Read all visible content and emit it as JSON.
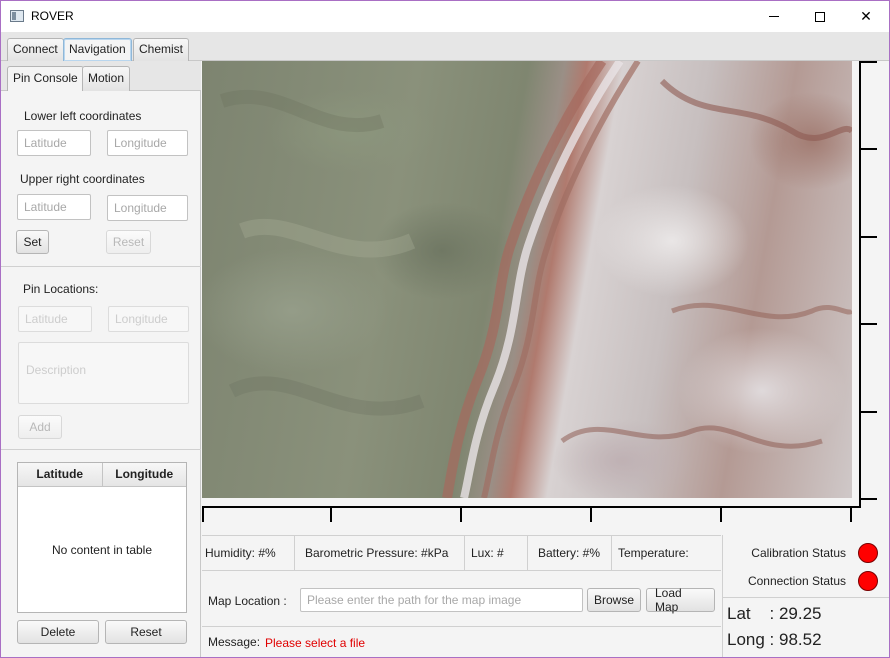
{
  "window": {
    "title": "ROVER"
  },
  "tabs": [
    "Connect",
    "Navigation",
    "Chemist"
  ],
  "selected_tab": "Navigation",
  "subtabs": [
    "Pin Console",
    "Motion"
  ],
  "selected_subtab": "Pin Console",
  "pin_console": {
    "lower_left_label": "Lower left coordinates",
    "upper_right_label": "Upper right coordinates",
    "latitude_placeholder": "Latitude",
    "longitude_placeholder": "Longitude",
    "set_label": "Set",
    "reset_label": "Reset",
    "pin_locations_label": "Pin Locations:",
    "description_placeholder": "Description",
    "add_label": "Add",
    "table": {
      "columns": [
        "Latitude",
        "Longitude"
      ],
      "empty_text": "No content in table"
    },
    "delete_label": "Delete",
    "reset_bottom_label": "Reset"
  },
  "sensors": {
    "humidity": "Humidity: #%",
    "pressure": "Barometric Pressure: #kPa",
    "lux": "Lux: #",
    "battery": "Battery: #%",
    "temperature": "Temperature:"
  },
  "map_location": {
    "label": "Map Location :",
    "placeholder": "Please enter the path for the map image",
    "browse_label": "Browse",
    "load_label": "Load Map"
  },
  "message": {
    "label": "Message:",
    "value": "Please select a file",
    "color": "#e00000"
  },
  "status": {
    "calibration_label": "Calibration Status",
    "connection_label": "Connection Status",
    "indicator_color": "#ff0000"
  },
  "coordinates": {
    "lat": "Lat    : 29.25",
    "long": "Long : 98.52"
  }
}
